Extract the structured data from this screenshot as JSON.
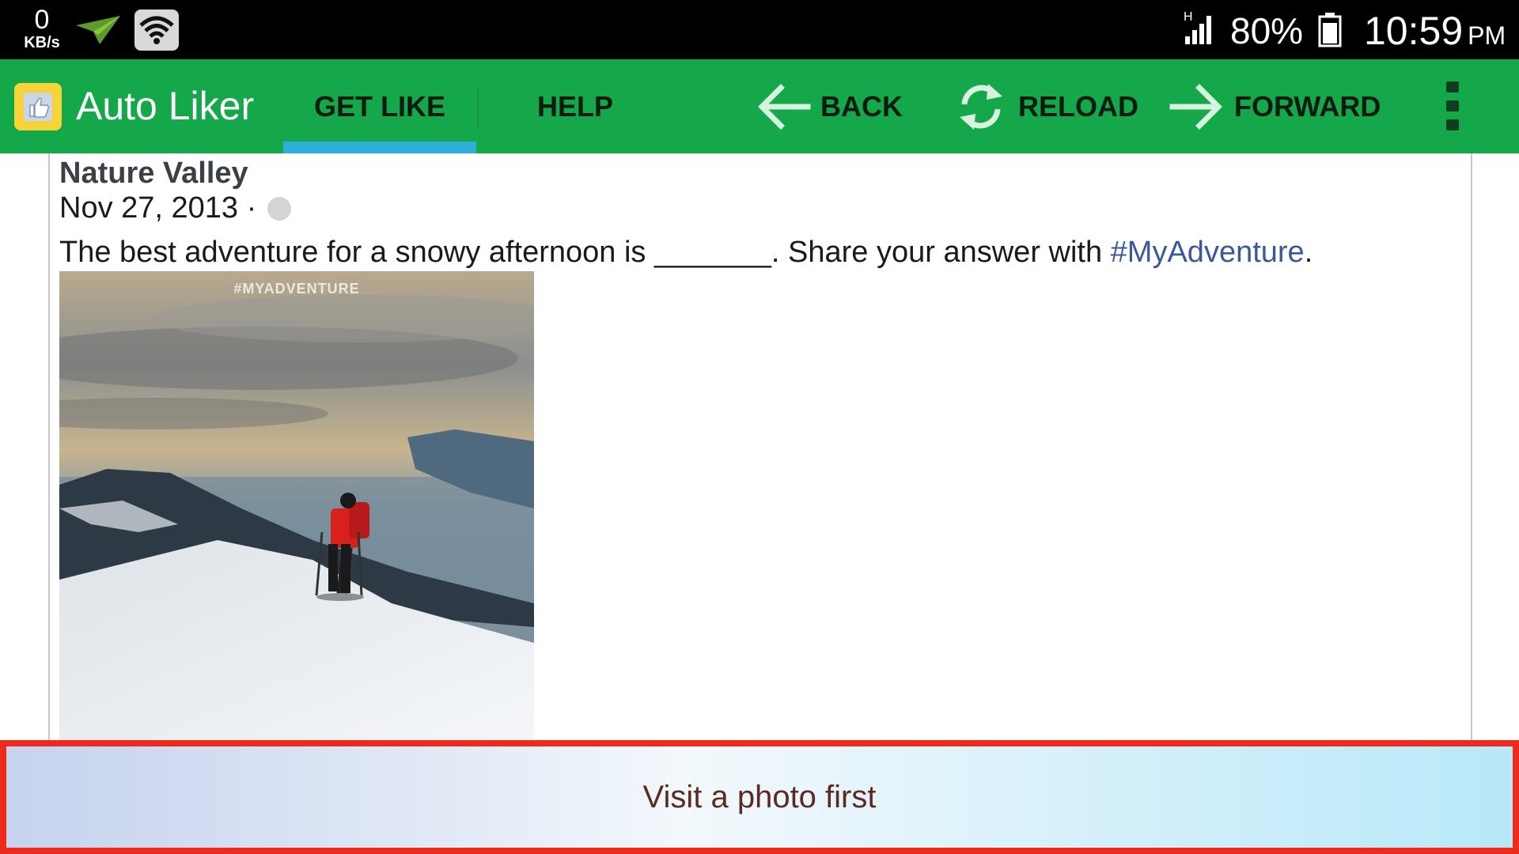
{
  "status_bar": {
    "net_speed_value": "0",
    "net_speed_unit": "KB/s",
    "network_type": "H",
    "battery_percent": "80%",
    "time": "10:59",
    "ampm": "PM",
    "icons": [
      "paper-plane-icon",
      "wifi-icon",
      "signal-icon",
      "battery-icon"
    ]
  },
  "action_bar": {
    "app_title": "Auto Liker",
    "tabs": [
      {
        "label": "GET LIKE",
        "selected": true
      },
      {
        "label": "HELP",
        "selected": false
      }
    ],
    "actions": [
      {
        "label": "BACK",
        "icon": "arrow-left-icon"
      },
      {
        "label": "RELOAD",
        "icon": "reload-icon"
      },
      {
        "label": "FORWARD",
        "icon": "arrow-right-icon"
      }
    ],
    "overflow_icon": "more-vert-icon",
    "colors": {
      "bar": "#14a84b",
      "tab_indicator": "#2eaedb"
    }
  },
  "post": {
    "author": "Nature Valley",
    "date": "Nov 27, 2013 ·",
    "text_before": "The best adventure for a snowy afternoon is _______. Share your answer with ",
    "hashtag": "#MyAdventure",
    "text_after": ".",
    "photo_caption": "#MYADVENTURE"
  },
  "banner": {
    "text": "Visit a photo first",
    "border_color": "#ee2a1c"
  }
}
